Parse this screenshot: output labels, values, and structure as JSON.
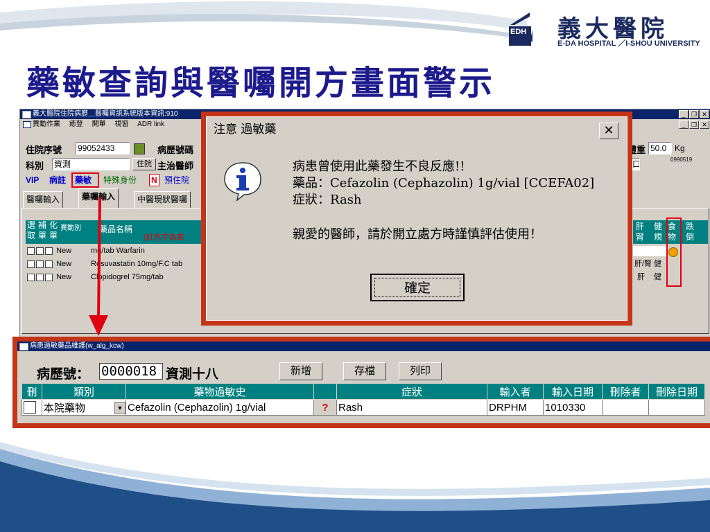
{
  "slide": {
    "title": "藥敏查詢與醫囑開方畫面警示",
    "logo_cn": "義大醫院",
    "logo_en": "E-DA HOSPITAL ／I-SHOU UNIVERSITY",
    "logo_box": "EDH"
  },
  "main_window": {
    "title": "義大醫院住院病歷＿醫囑資訊系統版本資訊:910",
    "menu": [
      "異動作業",
      "癒登",
      "開單",
      "視窗",
      "ADR link"
    ],
    "fields": {
      "admission_no_label": "住院序號",
      "admission_no": "99052433",
      "chart_no_label": "病歷號碼",
      "dept_label": "科別",
      "dept": "資測",
      "ward_btn": "住院",
      "doctor_label": "主治醫師",
      "weight_label": "體重",
      "weight": "50.0",
      "weight_unit": "Kg",
      "code_small": "0990519",
      "field_right": "口"
    },
    "tags": {
      "vip": "VIP",
      "disease_note": "病註",
      "allergy": "藥敏",
      "special_id": "特殊身份",
      "n_flag": "N",
      "pre_admit": "預住院"
    },
    "tabs": [
      "醫囑輸入",
      "藥囑輸入",
      "中醫現狀醫囑"
    ],
    "grid_headers": {
      "select": "選取",
      "supplement": "補單",
      "chemo": "化單",
      "change": "異動別",
      "drug_name": "藥品名稱",
      "red_note": "(紅色字為高",
      "liver_kidney": "肝腎",
      "health_rule": "健規",
      "food": "食物",
      "fall": "跌倒"
    },
    "rows": [
      {
        "status": "New",
        "drug": "mg/tab Warfarin",
        "lk": "",
        "hr": ""
      },
      {
        "status": "New",
        "drug": "Rosuvastatin 10mg/F.C tab",
        "lk": "肝/腎",
        "hr": "健"
      },
      {
        "status": "New",
        "drug": "Clopidogrel 75mg/tab",
        "lk": "肝",
        "hr": "健"
      }
    ]
  },
  "dialog": {
    "title": "注意 過敏藥",
    "close": "✕",
    "line1": "病患曾使用此藥發生不良反應!!",
    "line2": "藥品：Cefazolin (Cephazolin) 1g/vial [CCEFA02]",
    "line3": "症狀：Rash",
    "line4": "親愛的醫師，請於開立處方時謹慎評估使用！",
    "ok": "確定"
  },
  "allergy_window": {
    "title": "病患過敏藥品維護(w_alg_kcw)",
    "chart_label": "病歷號：",
    "chart_no": "0000018",
    "patient_name": "資測十八",
    "buttons": {
      "add": "新增",
      "save": "存檔",
      "print": "列印"
    },
    "headers": [
      "刪",
      "類別",
      "藥物過敏史",
      "",
      "症狀",
      "輸入者",
      "輸入日期",
      "刪除者",
      "刪除日期"
    ],
    "row": {
      "category": "本院藥物",
      "drug": "Cefazolin (Cephazolin) 1g/vial",
      "q": "?",
      "symptom": "Rash",
      "entered_by": "DRPHM",
      "entered_date": "1010330",
      "deleted_by": "",
      "deleted_date": ""
    }
  },
  "colors": {
    "accent_red": "#e00010",
    "frame_red": "#c43418",
    "title_blue": "#1c1a8c",
    "grid_teal": "#008080"
  }
}
